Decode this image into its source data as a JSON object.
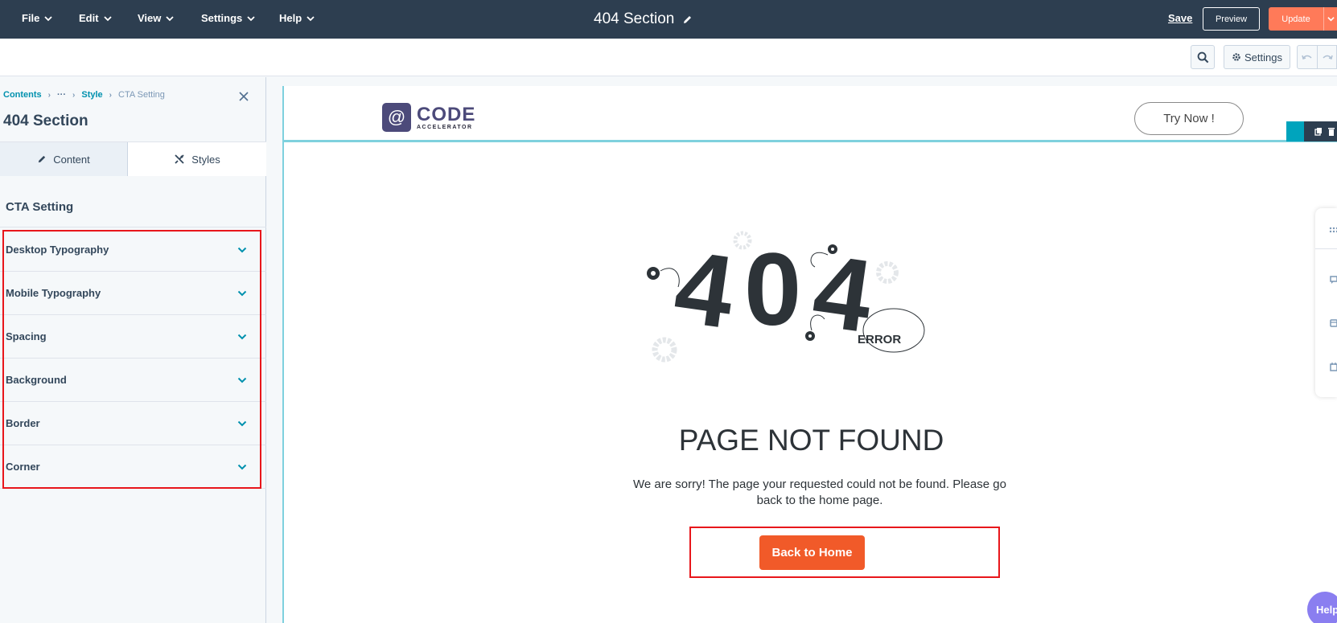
{
  "topbar": {
    "menus": [
      "File",
      "Edit",
      "View",
      "Settings",
      "Help"
    ],
    "doc_title": "404 Section",
    "save_label": "Save",
    "preview_label": "Preview",
    "update_label": "Update"
  },
  "subbar": {
    "settings_label": "Settings"
  },
  "panel": {
    "breadcrumb": {
      "root": "Contents",
      "ellipsis": "···",
      "parent": "Style",
      "current": "CTA Setting"
    },
    "title": "404 Section",
    "tabs": {
      "content": "Content",
      "styles": "Styles"
    },
    "section_title": "CTA Setting",
    "accordion": [
      "Desktop Typography",
      "Mobile Typography",
      "Spacing",
      "Background",
      "Border",
      "Corner"
    ]
  },
  "canvas": {
    "logo_big": "CODE",
    "logo_small": "ACCELERATOR",
    "try_now": "Try Now !",
    "art_digits": [
      "4",
      "0",
      "4"
    ],
    "error_label": "ERROR",
    "heading": "PAGE NOT FOUND",
    "message": "We are sorry! The page your requested could not be found. Please go back to the home page.",
    "cta_label": "Back to Home"
  },
  "help": {
    "label": "Help"
  },
  "colors": {
    "topbar": "#2d3e50",
    "accent_teal": "#0091ae",
    "update_orange": "#ff7a59",
    "cta_orange": "#f15a29",
    "highlight_red": "#e8161b"
  }
}
